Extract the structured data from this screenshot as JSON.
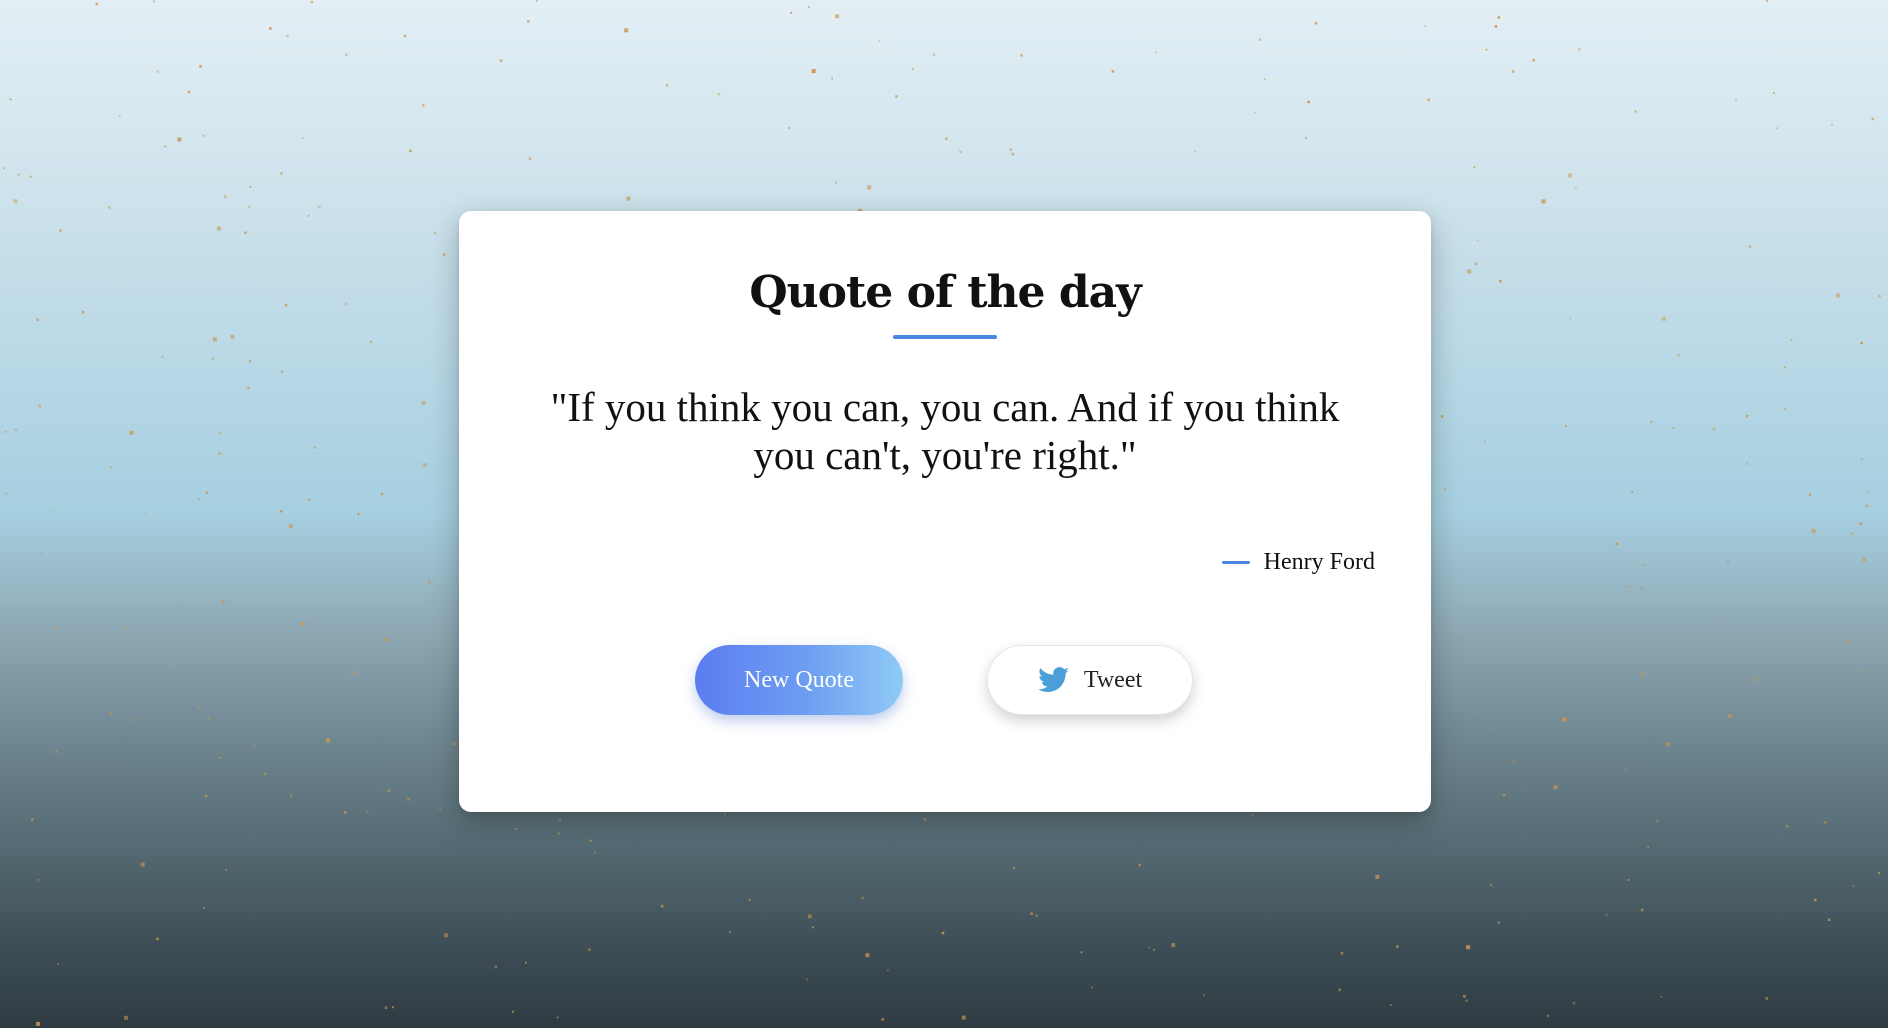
{
  "app": {
    "title": "Quote of the day"
  },
  "quote": {
    "text": "\"If you think you can, you can. And if you think you can't, you're right.\"",
    "author": "Henry Ford"
  },
  "buttons": {
    "new_quote_label": "New Quote",
    "tweet_label": "Tweet"
  },
  "icons": {
    "tweet_icon": "twitter-bird-icon"
  },
  "colors": {
    "accent": "#4a86e0",
    "new_quote_gradient_start": "#5b7cf0",
    "new_quote_gradient_end": "#8fcaf5",
    "twitter_blue": "#4a9fd8",
    "star_color": "#c9964f"
  }
}
